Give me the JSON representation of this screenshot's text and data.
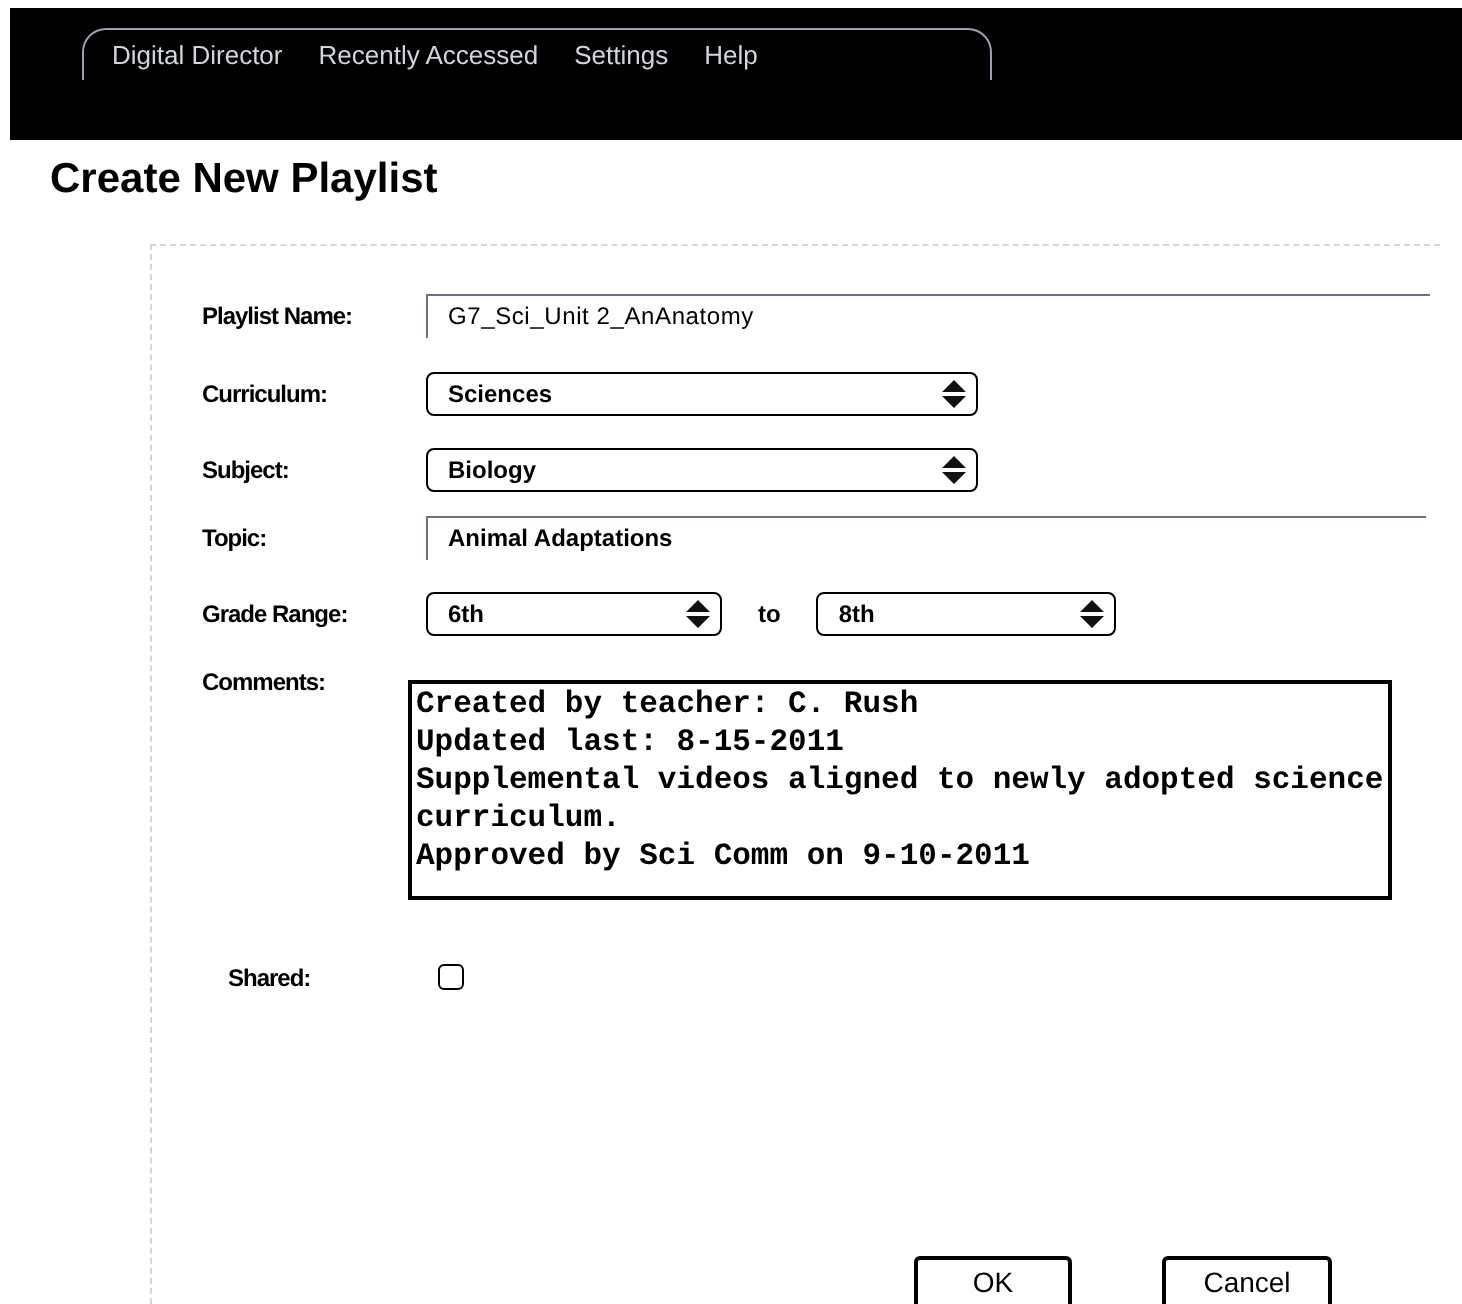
{
  "menu": [
    {
      "label": "Digital Director"
    },
    {
      "label": "Recently Accessed"
    },
    {
      "label": "Settings"
    },
    {
      "label": "Help"
    }
  ],
  "page_title": "Create New Playlist",
  "form": {
    "playlist_name": {
      "label": "Playlist Name:",
      "value": "G7_Sci_Unit 2_AnAnatomy"
    },
    "curriculum": {
      "label": "Curriculum:",
      "value": "Sciences"
    },
    "subject": {
      "label": "Subject:",
      "value": "Biology"
    },
    "topic": {
      "label": "Topic:",
      "value": "Animal Adaptations"
    },
    "grade_range": {
      "label": "Grade Range:",
      "from": "6th",
      "separator": "to",
      "to": "8th"
    },
    "comments": {
      "label": "Comments:",
      "value": "Created by teacher: C. Rush\nUpdated last: 8-15-2011\nSupplemental videos aligned to newly adopted science curriculum.\nApproved by Sci Comm on 9-10-2011"
    },
    "shared": {
      "label": "Shared:",
      "checked": false
    }
  },
  "buttons": [
    {
      "label": "OK"
    },
    {
      "label": "Cancel"
    }
  ]
}
